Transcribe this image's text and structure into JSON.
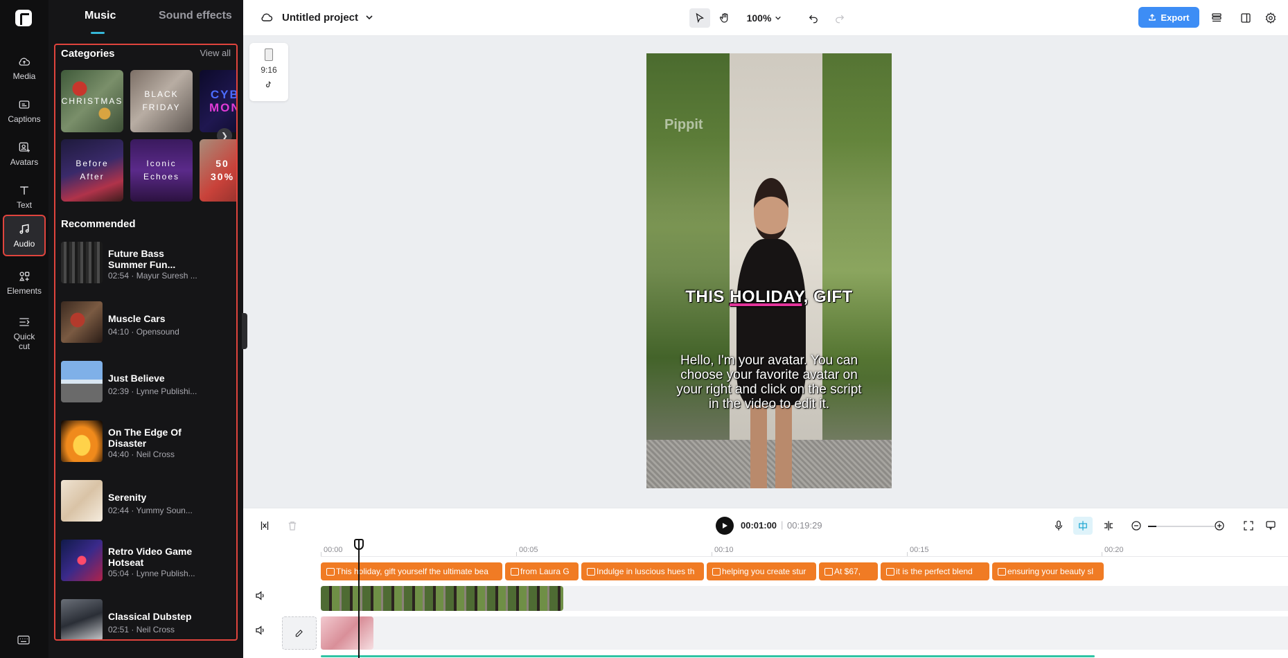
{
  "rail": {
    "items": [
      {
        "label": "Media",
        "icon": "cloud-icon"
      },
      {
        "label": "Captions",
        "icon": "captions-icon"
      },
      {
        "label": "Avatars",
        "icon": "avatar-icon"
      },
      {
        "label": "Text",
        "icon": "text-icon"
      },
      {
        "label": "Audio",
        "icon": "music-note-icon",
        "active": true
      },
      {
        "label": "Elements",
        "icon": "elements-icon"
      },
      {
        "label": "Quick",
        "label2": "cut",
        "icon": "quick-cut-icon"
      }
    ]
  },
  "panel": {
    "tabs": [
      "Music",
      "Sound effects"
    ],
    "active_tab": "Music",
    "categories_title": "Categories",
    "view_all": "View all",
    "categories": [
      {
        "line1": "CHRISTMAS",
        "line2": ""
      },
      {
        "line1": "BLACK",
        "line2": "FRIDAY"
      },
      {
        "line1": "CYB",
        "line2": "MON"
      },
      {
        "line1": "Before",
        "line2": "After"
      },
      {
        "line1": "Iconic",
        "line2": "Echoes"
      },
      {
        "line1": "50",
        "line2": "30%"
      }
    ],
    "recommended_title": "Recommended",
    "tracks": [
      {
        "title": "Future Bass Summer Fun...",
        "meta": "02:54 · Mayur Suresh ..."
      },
      {
        "title": "Muscle Cars",
        "meta": "04:10 · Opensound"
      },
      {
        "title": "Just Believe",
        "meta": "02:39 · Lynne Publishi..."
      },
      {
        "title": "On The Edge Of Disaster",
        "meta": "04:40 · Neil Cross"
      },
      {
        "title": "Serenity",
        "meta": "02:44 · Yummy Soun..."
      },
      {
        "title": "Retro Video Game Hotseat",
        "meta": "05:04 · Lynne Publish..."
      },
      {
        "title": "Classical Dubstep",
        "meta": "02:51 · Neil Cross"
      }
    ]
  },
  "topbar": {
    "project_title": "Untitled project",
    "zoom": "100%",
    "export_label": "Export",
    "accent": "#3d8df5"
  },
  "canvas": {
    "ratio_label": "9:16",
    "watermark": "Pippit",
    "caption_top": {
      "before": "THIS ",
      "highlight": "HOLIDAY,",
      "after": " GIFT"
    },
    "caption_bottom": "Hello, I'm your avatar. You can choose your favorite avatar on your right and click on the script in the video to edit it."
  },
  "timeline": {
    "current_time": "00:01:00",
    "separator": "|",
    "total_time": "00:19:29",
    "ruler": [
      "00:00",
      "00:05",
      "00:10",
      "00:15",
      "00:20"
    ],
    "caption_clips": [
      "This holiday, gift yourself the ultimate bea",
      "from Laura G",
      "Indulge in luscious hues th",
      "helping you create stur",
      "At $67,",
      "it is the perfect blend",
      "ensuring your beauty sl"
    ]
  }
}
